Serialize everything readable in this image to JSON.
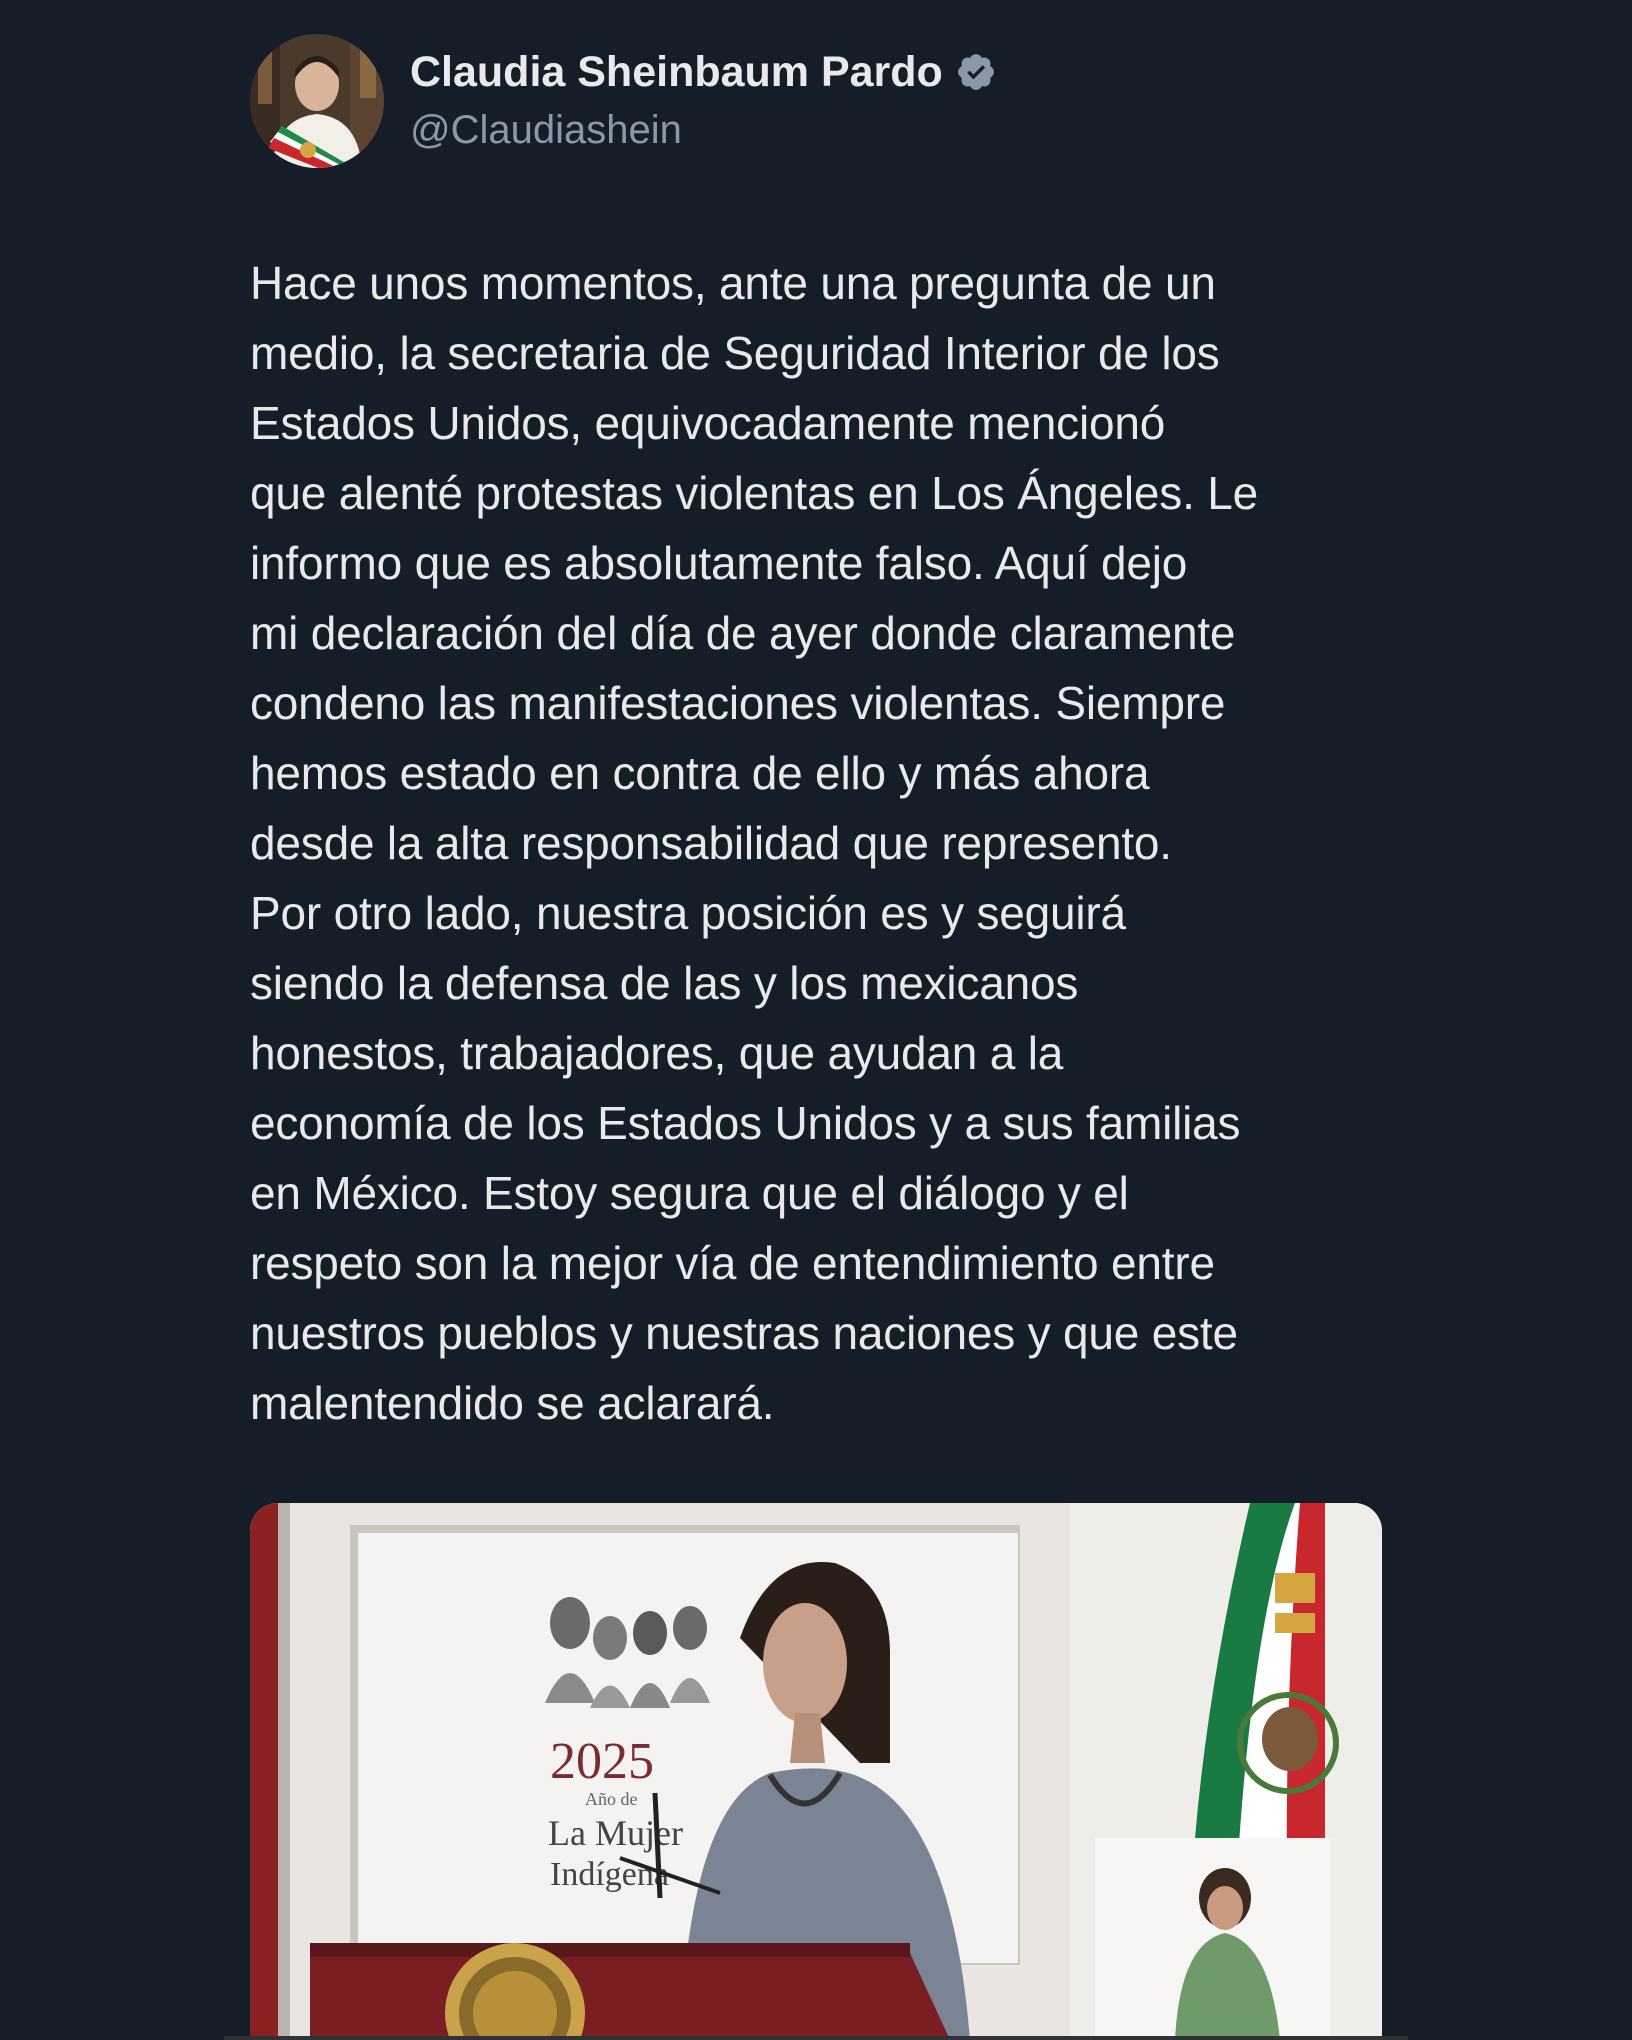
{
  "author": {
    "display_name": "Claudia Sheinbaum Pardo",
    "handle": "@Claudiashein",
    "verified": true
  },
  "tweet": {
    "text": "Hace unos momentos, ante una pregunta de un\nmedio, la secretaria de Seguridad Interior de los\nEstados Unidos, equivocadamente mencionó\nque alenté protestas violentas en Los Ángeles. Le\ninformo que es absolutamente falso. Aquí dejo\nmi declaración del día de ayer donde claramente\ncondeno las manifestaciones violentas. Siempre\nhemos estado en contra de ello y más ahora\ndesde la alta responsabilidad que represento.\nPor otro lado, nuestra posición es y seguirá\nsiendo la defensa de las y los mexicanos\nhonestos, trabajadores, que ayudan a la\neconomía de los Estados Unidos y a sus familias\nen México. Estoy segura que el diálogo y el\nrespeto son la mejor vía de entendimiento entre\nnuestros pueblos y nuestras naciones y que este\nmalentendido se aclarará."
  },
  "media": {
    "banner_year": "2025",
    "banner_line1": "Año de",
    "banner_line2": "La Mujer",
    "banner_line3": "Indígena"
  },
  "icons": {
    "verified": "verified-badge-icon"
  },
  "colors": {
    "background": "#151e28",
    "text": "#e7e9ea",
    "secondary_text": "#8b98a5",
    "verified_badge": "#8b98a5"
  }
}
